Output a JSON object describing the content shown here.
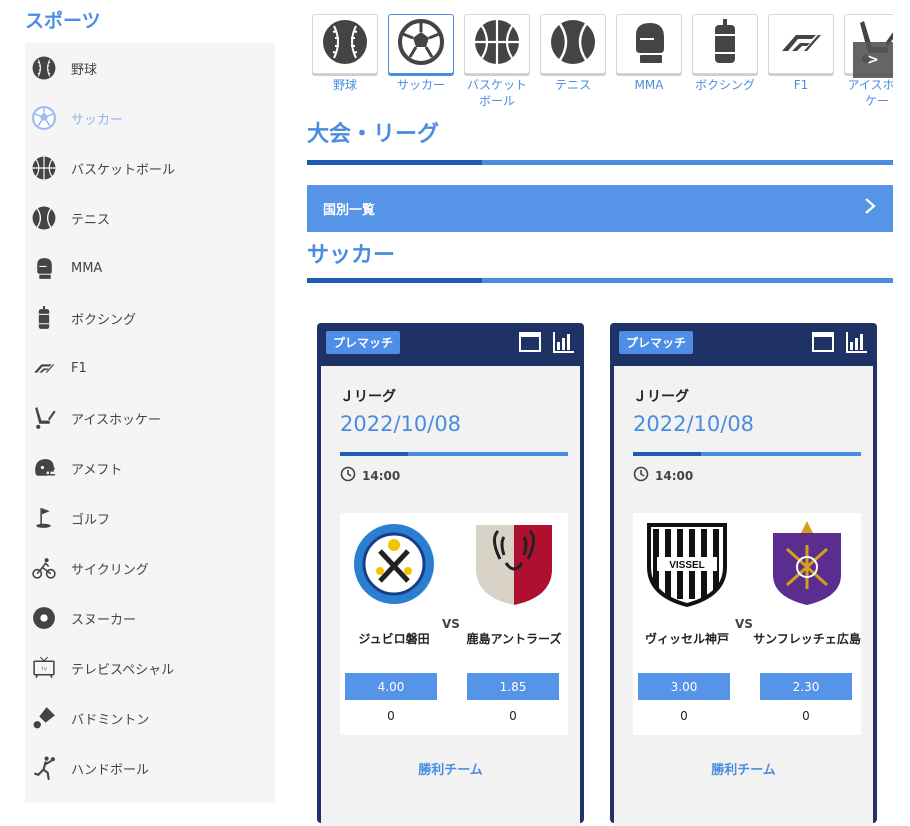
{
  "sidebar": {
    "title": "スポーツ",
    "items": [
      {
        "label": "野球",
        "icon": "baseball-icon"
      },
      {
        "label": "サッカー",
        "icon": "soccer-ball-icon",
        "active": true
      },
      {
        "label": "バスケットボール",
        "icon": "basketball-icon"
      },
      {
        "label": "テニス",
        "icon": "tennis-ball-icon"
      },
      {
        "label": "MMA",
        "icon": "boxing-glove-icon"
      },
      {
        "label": "ボクシング",
        "icon": "punching-bag-icon"
      },
      {
        "label": "F1",
        "icon": "f1-logo-icon"
      },
      {
        "label": "アイスホッケー",
        "icon": "hockey-icon"
      },
      {
        "label": "アメフト",
        "icon": "football-helmet-icon"
      },
      {
        "label": "ゴルフ",
        "icon": "golf-flag-icon"
      },
      {
        "label": "サイクリング",
        "icon": "cyclist-icon"
      },
      {
        "label": "スヌーカー",
        "icon": "snooker-ball-icon"
      },
      {
        "label": "テレビスペシャル",
        "icon": "tv-icon"
      },
      {
        "label": "バドミントン",
        "icon": "shuttlecock-icon"
      },
      {
        "label": "ハンドボール",
        "icon": "handball-player-icon"
      }
    ]
  },
  "tabs": [
    {
      "label": "野球",
      "icon": "baseball-icon"
    },
    {
      "label": "サッカー",
      "icon": "soccer-ball-icon",
      "active": true
    },
    {
      "label": "バスケット\nボール",
      "icon": "basketball-icon"
    },
    {
      "label": "テニス",
      "icon": "tennis-ball-icon"
    },
    {
      "label": "MMA",
      "icon": "boxing-glove-icon"
    },
    {
      "label": "ボクシング",
      "icon": "punching-bag-icon"
    },
    {
      "label": "F1",
      "icon": "f1-logo-icon"
    },
    {
      "label": "アイスホッケー",
      "icon": "hockey-icon"
    }
  ],
  "tabs_scroll_label": ">",
  "section_heading": "大会・リーグ",
  "country_list_label": "国別一覧",
  "sport_heading": "サッカー",
  "matches": [
    {
      "badge": "プレマッチ",
      "league": "Ｊリーグ",
      "date": "2022/10/08",
      "time": "14:00",
      "home_team": "ジュビロ磐田",
      "away_team": "鹿島アントラーズ",
      "vs": "VS",
      "home_odds": "4.00",
      "away_odds": "1.85",
      "home_count": "0",
      "away_count": "0",
      "win_label": "勝利チーム",
      "colors": {
        "home": "#2b7fd1",
        "away": "#b0102f"
      }
    },
    {
      "badge": "プレマッチ",
      "league": "Ｊリーグ",
      "date": "2022/10/08",
      "time": "14:00",
      "home_team": "ヴィッセル神戸",
      "away_team": "サンフレッチェ広島",
      "vs": "VS",
      "home_odds": "3.00",
      "away_odds": "2.30",
      "home_count": "0",
      "away_count": "0",
      "win_label": "勝利チーム",
      "colors": {
        "home": "#111111",
        "away": "#5b2d8e"
      }
    }
  ],
  "colors": {
    "accent": "#4a8de0",
    "accent_dark": "#1f5bb5",
    "card_header": "#1f3266"
  }
}
